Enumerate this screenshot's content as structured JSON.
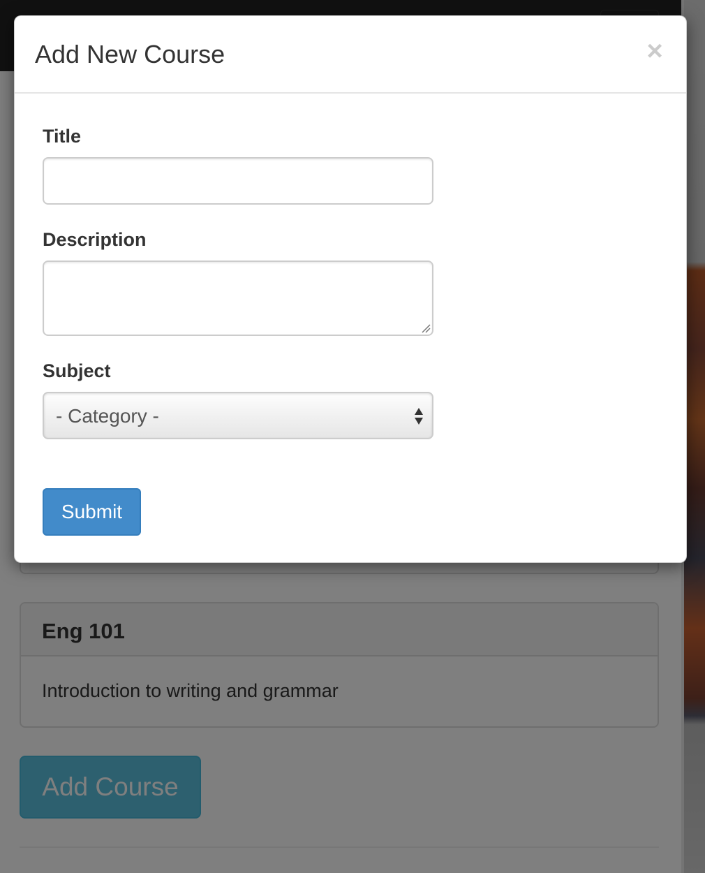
{
  "modal": {
    "title": "Add New Course",
    "close_glyph": "×",
    "fields": {
      "title": {
        "label": "Title",
        "value": "",
        "placeholder": ""
      },
      "description": {
        "label": "Description",
        "value": "",
        "placeholder": ""
      },
      "subject": {
        "label": "Subject",
        "selected": "- Category -"
      }
    },
    "submit_label": "Submit"
  },
  "background": {
    "course_panel": {
      "heading": "Eng 101",
      "body": "Introduction to writing and grammar"
    },
    "add_course_label": "Add Course"
  },
  "colors": {
    "primary": "#428bca",
    "info": "#5bc0de",
    "navbar": "#222222",
    "backdrop": "rgba(0,0,0,0.5)"
  },
  "icons": {
    "close": "close-icon",
    "select_arrows": "select-arrows-icon",
    "resize": "resize-grip-icon"
  }
}
